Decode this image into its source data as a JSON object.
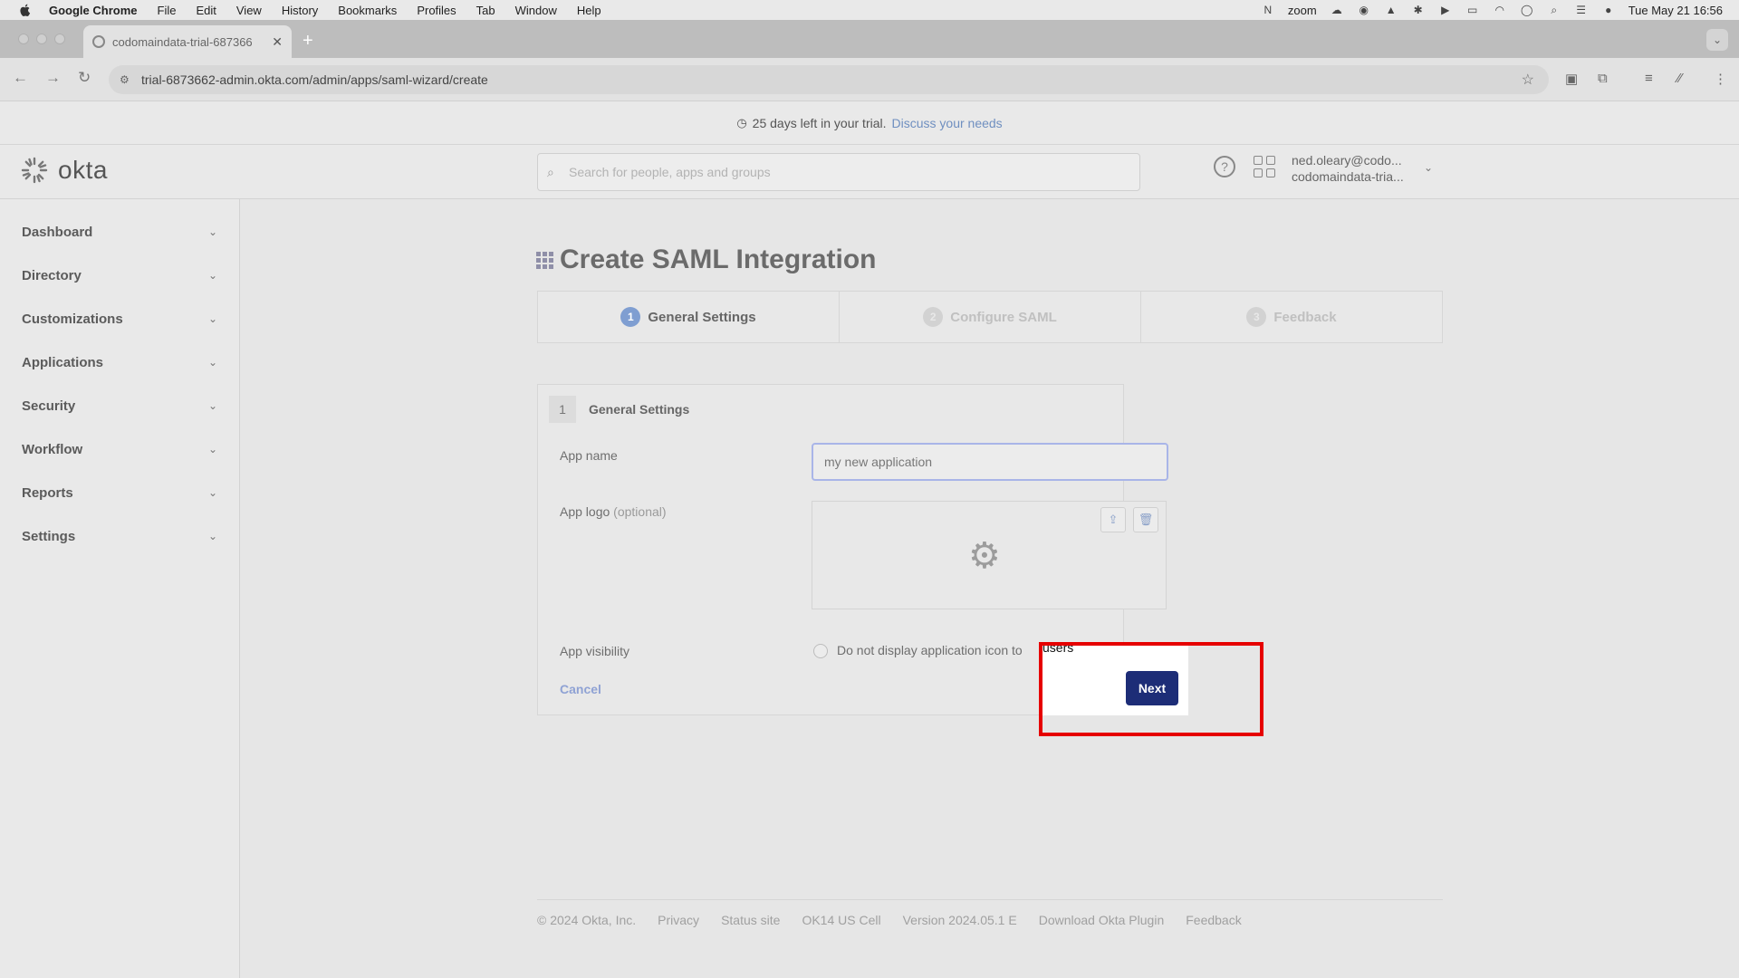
{
  "menubar": {
    "app_name": "Google Chrome",
    "items": [
      "File",
      "Edit",
      "View",
      "History",
      "Bookmarks",
      "Profiles",
      "Tab",
      "Window",
      "Help"
    ],
    "zoom_label": "zoom",
    "datetime": "Tue May 21  16:56"
  },
  "browser": {
    "tab_title": "codomaindata-trial-687366",
    "url": "trial-6873662-admin.okta.com/admin/apps/saml-wizard/create"
  },
  "banner": {
    "text": "25 days left in your trial.",
    "link": "Discuss your needs"
  },
  "header": {
    "logo_text": "okta",
    "search_placeholder": "Search for people, apps and groups",
    "user_email": "ned.oleary@codo...",
    "user_org": "codomaindata-tria..."
  },
  "sidebar": {
    "items": [
      {
        "label": "Dashboard"
      },
      {
        "label": "Directory"
      },
      {
        "label": "Customizations"
      },
      {
        "label": "Applications"
      },
      {
        "label": "Security"
      },
      {
        "label": "Workflow"
      },
      {
        "label": "Reports"
      },
      {
        "label": "Settings"
      }
    ]
  },
  "page": {
    "title": "Create SAML Integration",
    "steps": [
      {
        "num": "1",
        "label": "General Settings",
        "active": true
      },
      {
        "num": "2",
        "label": "Configure SAML",
        "active": false
      },
      {
        "num": "3",
        "label": "Feedback",
        "active": false
      }
    ]
  },
  "form": {
    "section_num": "1",
    "section_title": "General Settings",
    "app_name_label": "App name",
    "app_name_value": "my new application",
    "app_logo_label": "App logo",
    "app_logo_optional": "(optional)",
    "app_visibility_label": "App visibility",
    "visibility_option_prefix": "Do not display application icon to ",
    "visibility_option_suffix": "users",
    "cancel_label": "Cancel",
    "next_label": "Next"
  },
  "footer": {
    "items": [
      "© 2024 Okta, Inc.",
      "Privacy",
      "Status site",
      "OK14 US Cell",
      "Version 2024.05.1 E",
      "Download Okta Plugin",
      "Feedback"
    ]
  },
  "colors": {
    "highlight": "#e60000",
    "primary_button": "#1d2d77",
    "link": "#6f8fc0"
  }
}
